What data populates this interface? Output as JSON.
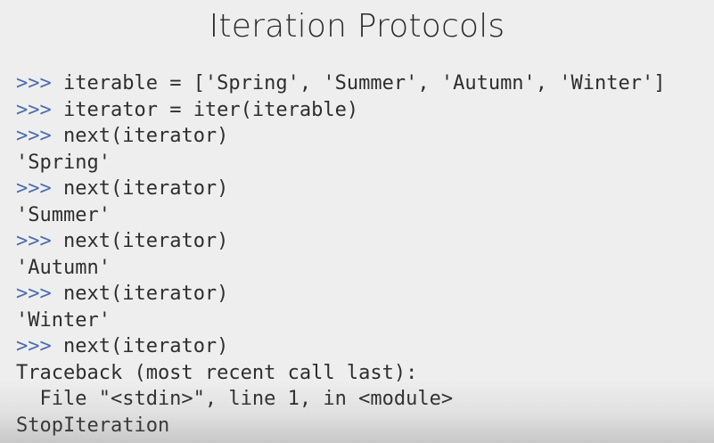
{
  "slide": {
    "title": "Iteration Protocols"
  },
  "colors": {
    "background": "#eeeeee",
    "prompt": "#4a6bb0",
    "text": "#2e2e2e"
  },
  "console": {
    "lines": [
      {
        "prompt": ">>>",
        "text": " iterable = ['Spring', 'Summer', 'Autumn', 'Winter']"
      },
      {
        "prompt": ">>>",
        "text": " iterator = iter(iterable)"
      },
      {
        "prompt": ">>>",
        "text": " next(iterator)"
      },
      {
        "prompt": "",
        "text": "'Spring'"
      },
      {
        "prompt": ">>>",
        "text": " next(iterator)"
      },
      {
        "prompt": "",
        "text": "'Summer'"
      },
      {
        "prompt": ">>>",
        "text": " next(iterator)"
      },
      {
        "prompt": "",
        "text": "'Autumn'"
      },
      {
        "prompt": ">>>",
        "text": " next(iterator)"
      },
      {
        "prompt": "",
        "text": "'Winter'"
      },
      {
        "prompt": ">>>",
        "text": " next(iterator)"
      },
      {
        "prompt": "",
        "text": "Traceback (most recent call last):"
      },
      {
        "prompt": "",
        "text": "  File \"<stdin>\", line 1, in <module>"
      },
      {
        "prompt": "",
        "text": "StopIteration"
      }
    ]
  }
}
